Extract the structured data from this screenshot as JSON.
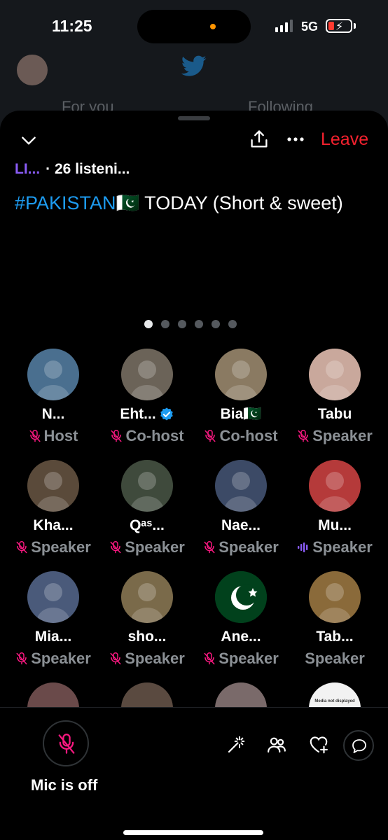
{
  "status": {
    "time": "11:25",
    "network": "5G"
  },
  "background_app": {
    "tab_for_you": "For you",
    "tab_following": "Following"
  },
  "header": {
    "leave_label": "Leave"
  },
  "space": {
    "host_short": "LI...",
    "listeners": "· 26 listeni...",
    "title_hashtag": "#PAKISTAN",
    "title_flag": "🇵🇰",
    "title_rest": " TODAY (Short & sweet)"
  },
  "pagination": {
    "count": 6,
    "active": 0
  },
  "speakers": [
    {
      "name": "N...",
      "role": "Host",
      "mic": "off",
      "avatar_color": "#4a6f8f"
    },
    {
      "name": "Eht...",
      "role": "Co-host",
      "mic": "off",
      "verified": true,
      "avatar_color": "#6b6358"
    },
    {
      "name": "Bia🇵🇰",
      "role": "Co-host",
      "mic": "off",
      "avatar_color": "#8a7a62"
    },
    {
      "name": "Tabu",
      "role": "Speaker",
      "mic": "off",
      "avatar_color": "#c9a89c"
    },
    {
      "name": "Kha...",
      "role": "Speaker",
      "mic": "off",
      "avatar_color": "#5a4a3a"
    },
    {
      "name": "Qᵃˢ...",
      "role": "Speaker",
      "mic": "off",
      "avatar_color": "#3f4a3c"
    },
    {
      "name": "Nae...",
      "role": "Speaker",
      "mic": "off",
      "avatar_color": "#3c4a66"
    },
    {
      "name": "Mu...",
      "role": "Speaker",
      "mic": "speaking",
      "avatar_color": "#b53a3a"
    },
    {
      "name": "Mia...",
      "role": "Speaker",
      "mic": "off",
      "avatar_color": "#4a5a7a"
    },
    {
      "name": "sho...",
      "role": "Speaker",
      "mic": "off",
      "avatar_color": "#7a6a4a"
    },
    {
      "name": "Ane...",
      "role": "Speaker",
      "mic": "off",
      "avatar_color": "#01411c"
    },
    {
      "name": "Tab...",
      "role": "Speaker",
      "mic": "none",
      "avatar_color": "#8a6a3a"
    }
  ],
  "partial_row": [
    {
      "avatar_color": "#6a4a4a"
    },
    {
      "avatar_color": "#5a4a40"
    },
    {
      "avatar_color": "#7a6a6a"
    },
    {
      "avatar_color": "#f2f2f2",
      "placeholder_text": "Media not displayed"
    }
  ],
  "footer": {
    "mic_label": "Mic is off"
  },
  "colors": {
    "accent_red": "#f4212e",
    "twitter_blue": "#1d9bf0",
    "mic_off_pink": "#f91880",
    "host_purple": "#8a5cf6"
  }
}
